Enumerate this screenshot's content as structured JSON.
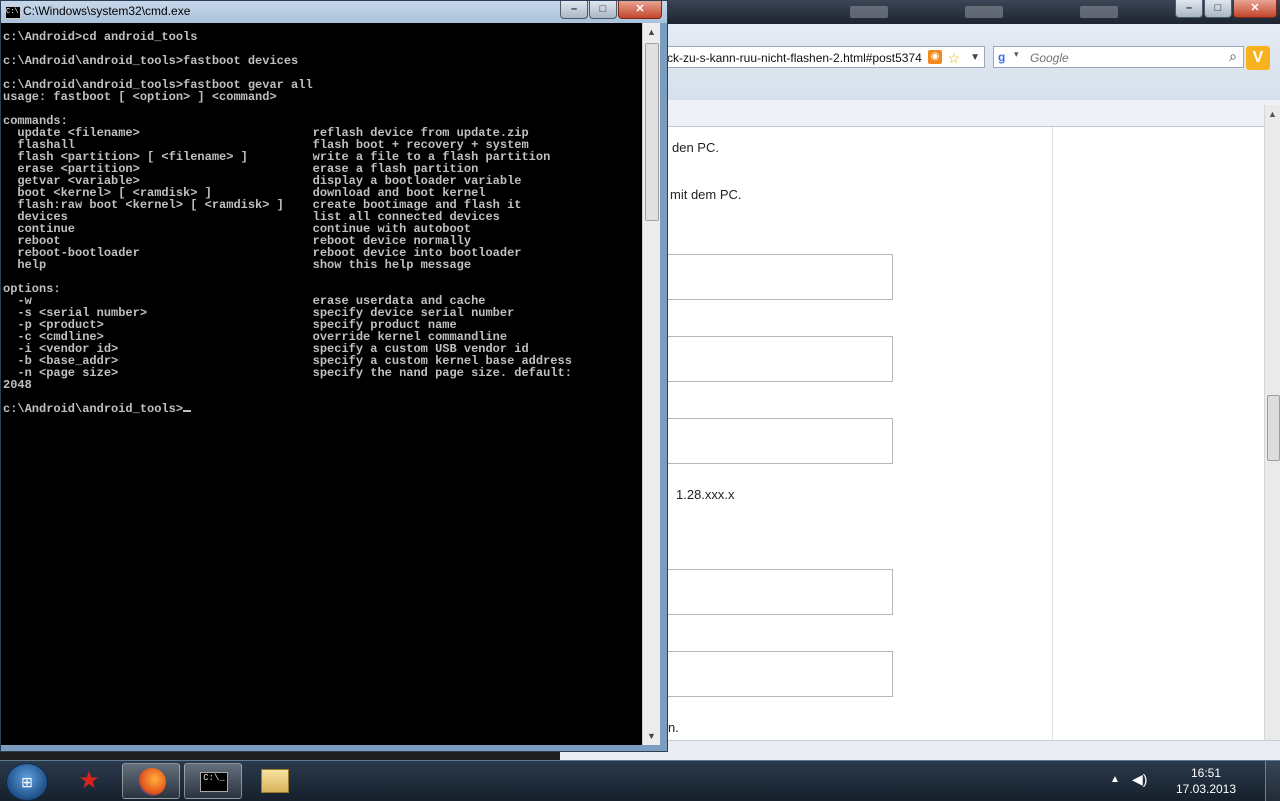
{
  "browser": {
    "url": "ck-zu-s-kann-ruu-nicht-flashen-2.html#post5374",
    "search_placeholder": "Google",
    "page_text": {
      "line1": "den PC.",
      "line2": "mit dem PC.",
      "line3": "1.28.xxx.x",
      "line4": "n."
    }
  },
  "cmd": {
    "title": "C:\\Windows\\system32\\cmd.exe",
    "icon_label": "C:\\",
    "output": "c:\\Android>cd android_tools\n\nc:\\Android\\android_tools>fastboot devices\n\nc:\\Android\\android_tools>fastboot gevar all\nusage: fastboot [ <option> ] <command>\n\ncommands:\n  update <filename>                        reflash device from update.zip\n  flashall                                 flash boot + recovery + system\n  flash <partition> [ <filename> ]         write a file to a flash partition\n  erase <partition>                        erase a flash partition\n  getvar <variable>                        display a bootloader variable\n  boot <kernel> [ <ramdisk> ]              download and boot kernel\n  flash:raw boot <kernel> [ <ramdisk> ]    create bootimage and flash it\n  devices                                  list all connected devices\n  continue                                 continue with autoboot\n  reboot                                   reboot device normally\n  reboot-bootloader                        reboot device into bootloader\n  help                                     show this help message\n\noptions:\n  -w                                       erase userdata and cache\n  -s <serial number>                       specify device serial number\n  -p <product>                             specify product name\n  -c <cmdline>                             override kernel commandline\n  -i <vendor id>                           specify a custom USB vendor id\n  -b <base_addr>                           specify a custom kernel base address\n  -n <page size>                           specify the nand page size. default:\n2048\n\nc:\\Android\\android_tools>"
  },
  "window_buttons": {
    "minimize": "–",
    "maximize": "□",
    "close": "✕"
  },
  "taskbar": {
    "start_glyph": "⊞",
    "cmd_label": "C:\\_",
    "time": "16:51",
    "date": "17.03.2013"
  },
  "icons": {
    "rss": "rss-feed-icon",
    "star": "bookmark-star-icon",
    "search": "magnifier-icon",
    "volume": "speaker-icon"
  }
}
